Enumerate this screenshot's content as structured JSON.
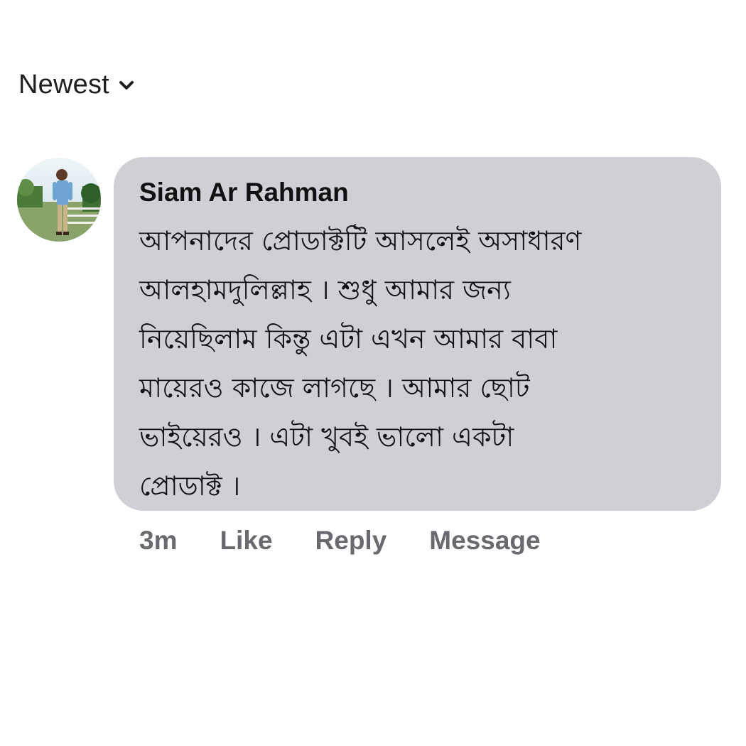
{
  "sort": {
    "label": "Newest",
    "icon": "chevron-down-icon"
  },
  "comment": {
    "author": "Siam Ar Rahman",
    "lines": [
      "আপনাদের প্রোডাক্টটি আসলেই অসাধারণ",
      "আলহামদুলিল্লাহ । শুধু আমার জন্য",
      "নিয়েছিলাম কিন্তু এটা এখন আমার বাবা",
      "মায়েরও কাজে লাগছে । আমার ছোট",
      "ভাইয়েরও । এটা খুবই ভালো একটা",
      "প্রোডাক্ট ।"
    ],
    "bubble_color": "#cfd0d6"
  },
  "actions": {
    "time": "3m",
    "like": "Like",
    "reply": "Reply",
    "message": "Message"
  },
  "colors": {
    "action_text": "#686a70",
    "author_text": "#111111"
  }
}
